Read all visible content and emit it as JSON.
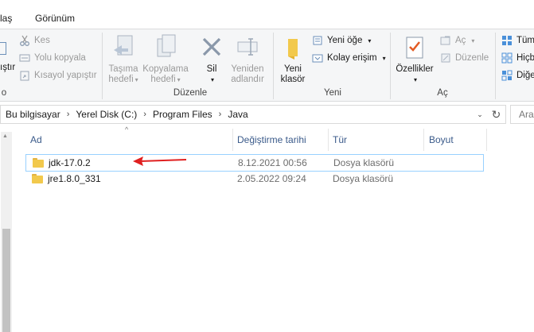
{
  "tabs": [
    "laş",
    "Görünüm"
  ],
  "ribbon": {
    "clipboard": {
      "cut": "Kes",
      "copy_path": "Yolu kopyala",
      "paste_shortcut": "Kısayol yapıştır",
      "paste_partial": "ıştır",
      "group_partial": "o"
    },
    "organize": {
      "move_to_line1": "Taşıma",
      "move_to_line2": "hedefi",
      "copy_to_line1": "Kopyalama",
      "copy_to_line2": "hedefi",
      "delete": "Sil",
      "rename_line1": "Yeniden",
      "rename_line2": "adlandır",
      "label": "Düzenle"
    },
    "new": {
      "new_folder_line1": "Yeni",
      "new_folder_line2": "klasör",
      "new_item": "Yeni öğe",
      "easy_access": "Kolay erişim",
      "label": "Yeni"
    },
    "open": {
      "properties": "Özellikler",
      "open": "Aç",
      "edit": "Düzenle",
      "label": "Aç"
    },
    "select": {
      "select_all_partial": "Tüm",
      "select_none_partial": "Hiçb",
      "invert_partial": "Diğe"
    }
  },
  "address": {
    "crumbs": [
      "Bu bilgisayar",
      "Yerel Disk (C:)",
      "Program Files",
      "Java"
    ],
    "search_partial": "Ara"
  },
  "columns": {
    "name": "Ad",
    "date": "Değiştirme tarihi",
    "type": "Tür",
    "size": "Boyut"
  },
  "files": [
    {
      "name": "jdk-17.0.2",
      "date": "8.12.2021 00:56",
      "type": "Dosya klasörü",
      "size": ""
    },
    {
      "name": "jre1.8.0_331",
      "date": "2.05.2022 09:24",
      "type": "Dosya klasörü",
      "size": ""
    }
  ],
  "colors": {
    "accent": "#3a5a8a",
    "selection_border": "#99d1ff",
    "annotation": "#e02020",
    "folder": "#f2c94c"
  }
}
